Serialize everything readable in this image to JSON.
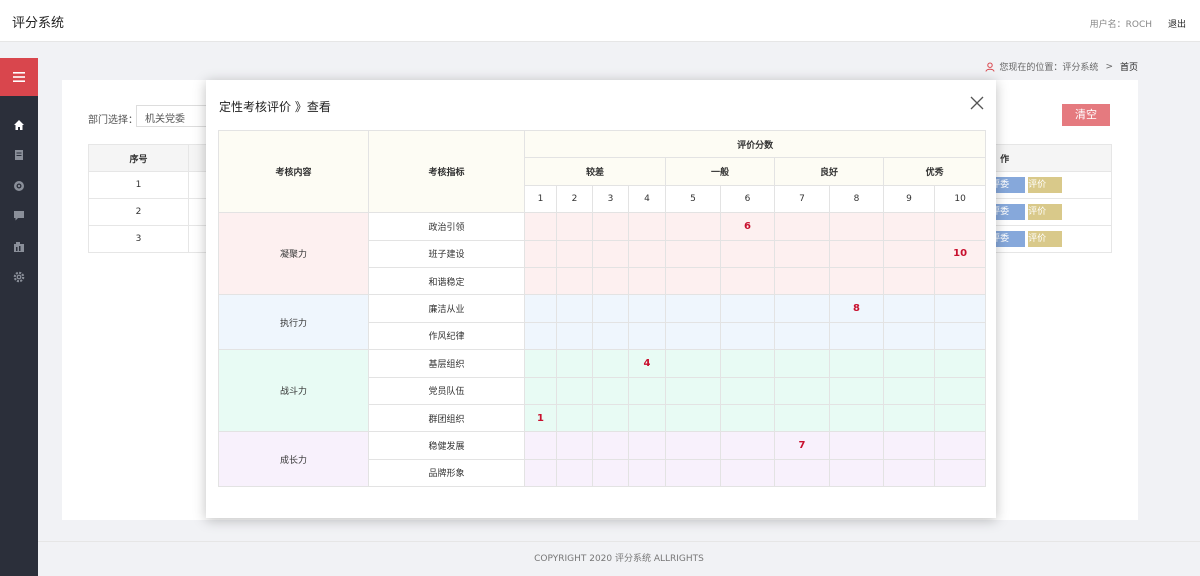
{
  "app": {
    "title": "评分系统",
    "user_label": "用户名：ROCH",
    "logout": "退出"
  },
  "breadcrumb": {
    "prefix": "您现在的位置：评分系统",
    "separator": ">",
    "current": "首页"
  },
  "filter": {
    "dept_label": "部门选择：",
    "dept_value": "机关党委",
    "clear_button": "清空"
  },
  "bg_table": {
    "col_no": "序号",
    "col_action": "作",
    "rows": [
      {
        "no": "1",
        "btn1": "评委",
        "btn2": "评价"
      },
      {
        "no": "2",
        "btn1": "评委",
        "btn2": "评价"
      },
      {
        "no": "3",
        "btn1": "评委",
        "btn2": "评价"
      }
    ]
  },
  "modal": {
    "title": "定性考核评价 》查看",
    "head": {
      "content": "考核内容",
      "indicator": "考核指标",
      "score": "评价分数",
      "levels": [
        {
          "label": "较差",
          "span": 4
        },
        {
          "label": "一般",
          "span": 2
        },
        {
          "label": "良好",
          "span": 2
        },
        {
          "label": "优秀",
          "span": 2
        }
      ],
      "numbers": [
        "1",
        "2",
        "3",
        "4",
        "5",
        "6",
        "7",
        "8",
        "9",
        "10"
      ]
    },
    "groups": [
      {
        "name": "凝聚力",
        "color": "pink",
        "items": [
          {
            "label": "政治引领",
            "score": 6
          },
          {
            "label": "班子建设",
            "score": 10
          },
          {
            "label": "和谐稳定",
            "score": null
          }
        ]
      },
      {
        "name": "执行力",
        "color": "blue",
        "items": [
          {
            "label": "廉洁从业",
            "score": 8
          },
          {
            "label": "作风纪律",
            "score": null
          }
        ]
      },
      {
        "name": "战斗力",
        "color": "green",
        "items": [
          {
            "label": "基层组织",
            "score": 4
          },
          {
            "label": "党员队伍",
            "score": null
          },
          {
            "label": "群团组织",
            "score": 1
          }
        ]
      },
      {
        "name": "成长力",
        "color": "purple",
        "items": [
          {
            "label": "稳健发展",
            "score": 7
          },
          {
            "label": "品牌形象",
            "score": null
          }
        ]
      }
    ]
  },
  "footer": {
    "text": "COPYRIGHT 2020 评分系统 ALLRIGHTS"
  },
  "colors": {
    "accent_red": "#d9464d",
    "sidebar": "#2b2f3a",
    "score": "#c8102e"
  }
}
